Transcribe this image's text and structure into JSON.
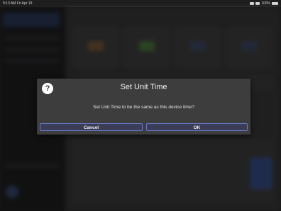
{
  "status_bar": {
    "time": "9:13 AM  Fri Apr 19",
    "battery": "100%"
  },
  "dialog": {
    "help_icon": "?",
    "title": "Set Unit Time",
    "message": "Set Unit Time to be the same as this device time?",
    "cancel_label": "Cancel",
    "ok_label": "OK"
  },
  "colors": {
    "dialog_bg": "#3d3d3d",
    "button_border": "#6a79c8",
    "overlay": "#000000"
  },
  "icons": [
    "help-icon",
    "signal-icon",
    "wifi-icon",
    "battery-icon"
  ]
}
